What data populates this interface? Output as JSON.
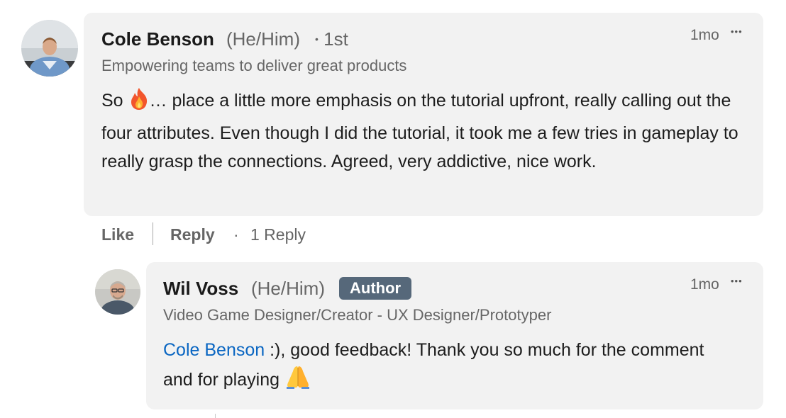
{
  "comment": {
    "author_name": "Cole Benson",
    "pronouns": "(He/Him)",
    "separator": "•",
    "connection_degree": "1st",
    "headline": "Empowering teams to deliver great products",
    "time": "1mo",
    "more_label": "•••",
    "body_start": "So ",
    "body_rest": "… place a little more emphasis on the tutorial upfront, really calling out the four attributes. Even though I did the tutorial, it took me a few tries in gameplay to really grasp the connections. Agreed, very addictive, nice work.",
    "actions": {
      "like_label": "Like",
      "reply_label": "Reply",
      "dot": "·",
      "reply_count": "1 Reply"
    }
  },
  "reply": {
    "author_name": "Wil Voss",
    "pronouns": "(He/Him)",
    "badge": "Author",
    "headline": "Video Game Designer/Creator - UX Designer/Prototyper",
    "time": "1mo",
    "more_label": "•••",
    "mention": "Cole Benson",
    "body_rest": " :), good feedback! Thank you so much for the comment and for playing "
  },
  "colors": {
    "bubble": "#f2f2f2",
    "badge": "#56687a",
    "mention": "#0a66c2",
    "muted_text": "#666666"
  },
  "icons": {
    "comment_emoji": "fire-emoji",
    "reply_emoji": "folded-hands-emoji"
  }
}
